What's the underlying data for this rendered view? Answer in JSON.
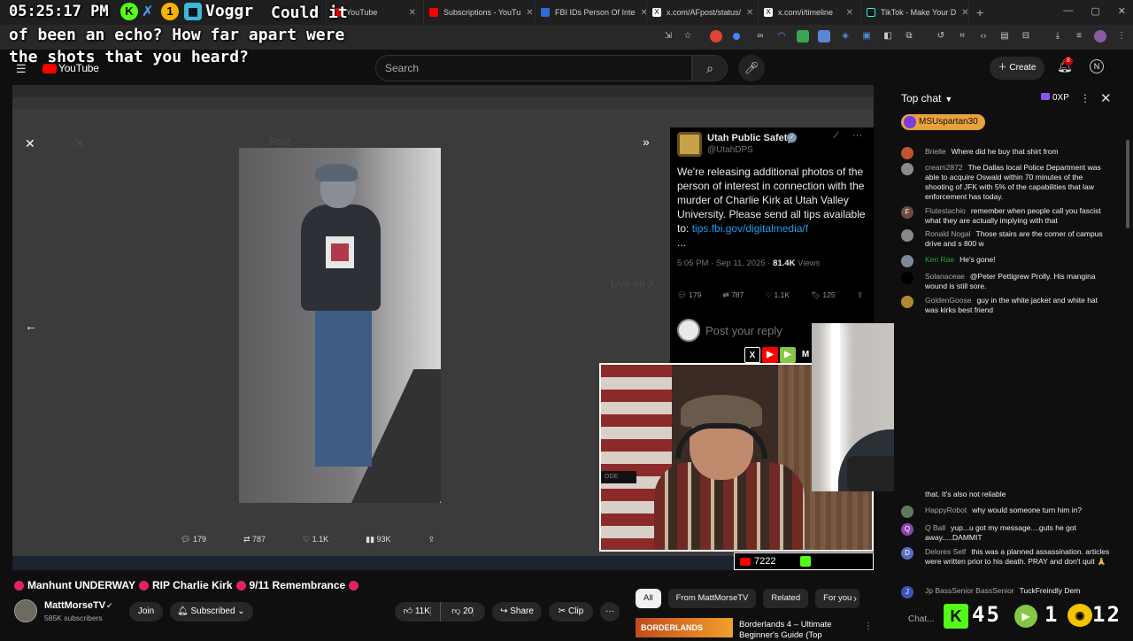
{
  "browser": {
    "tabs": [
      {
        "label": "",
        "color": "#4a90d9"
      },
      {
        "label": "YouTube",
        "color": "#ff0000"
      },
      {
        "label": "Subscriptions - YouTu",
        "color": "#ff0000"
      },
      {
        "label": "FBI IDs Person Of Inte",
        "color": "#2f6ad9"
      },
      {
        "label": "x.com/AFpost/status/",
        "color": "#ffffff"
      },
      {
        "label": "x.com/i/timeline",
        "color": "#ffffff"
      },
      {
        "label": "TikTok - Make Your D",
        "color": "#ffffff"
      }
    ],
    "new_tab": "+"
  },
  "overlay": {
    "clock": "05:25:17 PM",
    "k_badge": "K",
    "x_badge": "✗",
    "n_badge": "1",
    "vog_badge": "▦",
    "username": "Voggr",
    "message_line1": "Could it",
    "message_line2": "of been an echo? How far apart were",
    "message_line3": "the shots that you heard?"
  },
  "youtube": {
    "logo": "YouTube",
    "search_placeholder": "Search",
    "create_label": "Create",
    "notif_count": "8",
    "avatar_letter": "N"
  },
  "tweet": {
    "name": "Utah Public Safety",
    "handle": "@UtahDPS",
    "body": "We're releasing additional photos of the person of interest in connection with the murder of Charlie Kirk at Utah Valley University. Please send all tips available to: ",
    "link": "tips.fbi.gov/digitalmedia/f",
    "ellipsis": "...",
    "time": "5:05 PM · Sep 11, 2025 · ",
    "views": "81.4K",
    "views_label": " Views",
    "replies": "179",
    "reposts": "787",
    "likes": "1.1K",
    "bookmarks": "125",
    "reply_placeholder": "Post your reply"
  },
  "video_stats": {
    "replies": "179",
    "reposts": "787",
    "likes": "1.1K",
    "views": "93K"
  },
  "viewers": "7222",
  "chat": {
    "header": "Top chat",
    "xp": "0XP",
    "pinned_user": "MSUspartan30",
    "messages": [
      {
        "author": "Brielle",
        "text": "Where did he buy that shirt from",
        "color": "#c0552f",
        "green": false
      },
      {
        "author": "cream2872",
        "text": "The Dallas local Police Department was able to acquire Oswald within 70 minutes of the shooting of JFK with 5% of the capabilities that law enforcement has today.",
        "color": "#8a8a8a",
        "green": false
      },
      {
        "author": "Flutestachio",
        "text": "remember when people call you fascist what they are actually implying with that",
        "color": "#6d4c41",
        "green": false
      },
      {
        "author": "Ronald Nogal",
        "text": "Those stairs are the corner of campus drive and s 800 w",
        "color": "#888888",
        "green": false
      },
      {
        "author": "Keri Rae",
        "text": "He's gone!",
        "color": "#7d8a9a",
        "green": true
      },
      {
        "author": "Solanaceae",
        "text": "@Peter Pettigrew Prolly. His mangina wound is still sore.",
        "color": "#000000",
        "green": false
      },
      {
        "author": "GoldenGoose",
        "text": "guy in the white jacket and white hat was kirks best friend",
        "color": "#b08a2e",
        "green": false
      },
      {
        "author": "",
        "text": "that. It's also not reliable",
        "color": "#0f0f0f",
        "green": false
      },
      {
        "author": "HappyRobot",
        "text": "why would someone turn him in?",
        "color": "#5d7a5d",
        "green": false
      },
      {
        "author": "Q Ball",
        "text": "yup...u got my message....guts he got away.....DAMMIT",
        "color": "#8e44ad",
        "green": false
      },
      {
        "author": "Delores Self",
        "text": "this was a planned assassination. articles were written prior to his death. PRAY and don't quit 🙏",
        "color": "#5c6bc0",
        "green": false
      },
      {
        "author": "Jp BassSenior BassSenior",
        "text": "TuckFreindly Dem",
        "color": "#3f51b5",
        "green": false
      }
    ],
    "avatar_letters": [
      "",
      "",
      "F",
      "",
      "",
      "",
      "",
      "",
      "",
      "Q",
      "D",
      "J"
    ],
    "input_placeholder": "Chat..."
  },
  "counters": {
    "kick_icon": "K",
    "kick_count": "45",
    "rumble_icon": "▶",
    "rumble_count": "1",
    "twitch_icon": "◉",
    "twitch_count": "12"
  },
  "video_info": {
    "title_part1": "Manhunt UNDERWAY",
    "title_part2": "RIP Charlie Kirk",
    "title_part3": "9/11 Remembrance",
    "channel": "MattMorseTV",
    "subscribers": "585K subscribers",
    "join": "Join",
    "subscribed": "Subscribed",
    "like_count": "11K",
    "dislike_count": "20",
    "share": "Share",
    "clip": "Clip"
  },
  "chips": [
    "All",
    "From MattMorseTV",
    "Related",
    "For you"
  ],
  "recommended": {
    "thumb_text": "BORDERLANDS",
    "title": "Borderlands 4 – Ultimate Beginner's Guide (Top"
  },
  "colors": {
    "yt_red": "#ff0000",
    "kick_green": "#53fc18",
    "x_link": "#1d9bf0"
  }
}
